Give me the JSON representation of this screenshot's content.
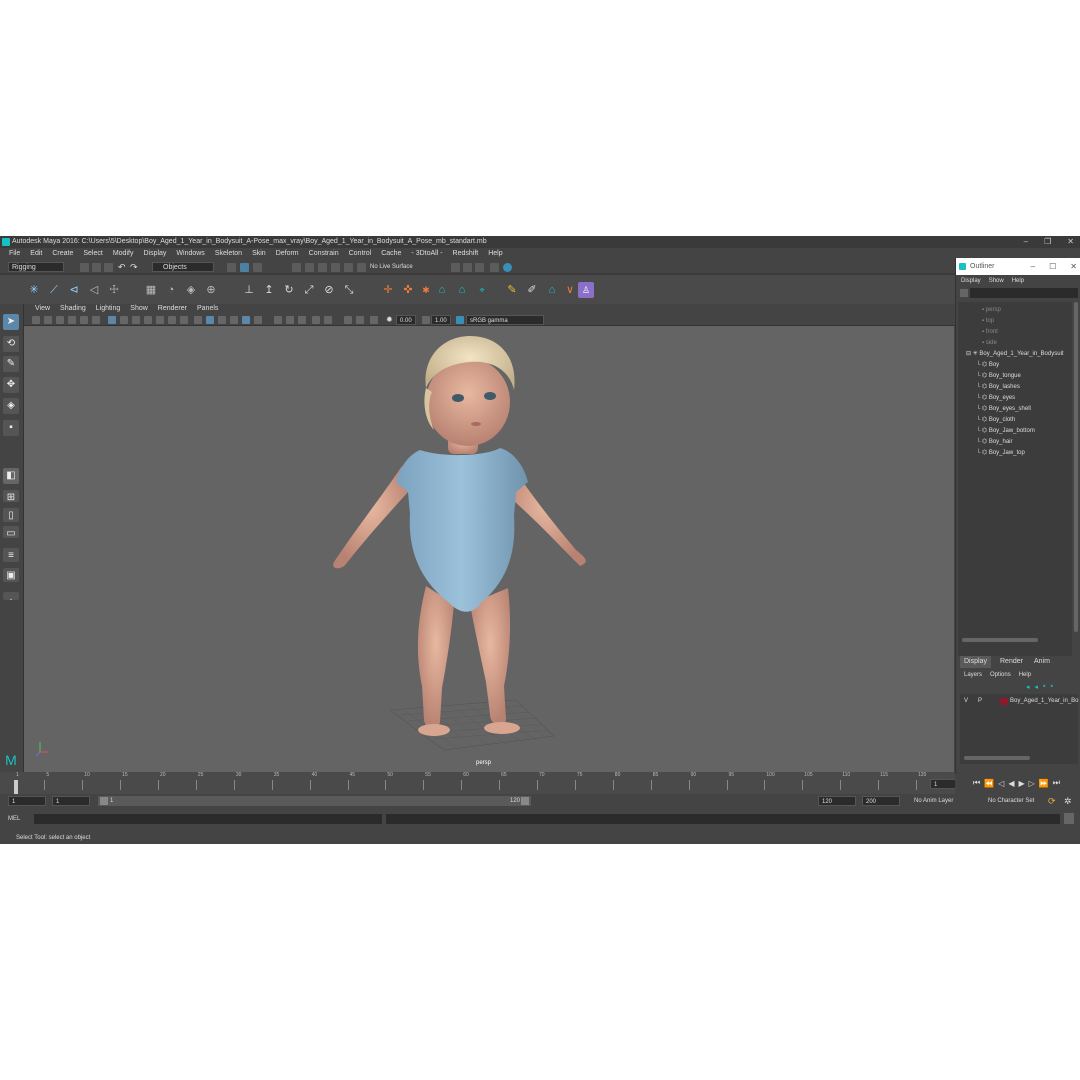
{
  "window": {
    "title": "Autodesk Maya 2016: C:\\Users\\5\\Desktop\\Boy_Aged_1_Year_in_Bodysuit_A-Pose_max_vray\\Boy_Aged_1_Year_in_Bodysuit_A_Pose_mb_standart.mb",
    "minimize": "–",
    "maximize": "❐",
    "close": "✕"
  },
  "menubar": [
    "File",
    "Edit",
    "Create",
    "Select",
    "Modify",
    "Display",
    "Windows",
    "Skeleton",
    "Skin",
    "Deform",
    "Constrain",
    "Control",
    "Cache",
    "- 3DtoAll -",
    "Redshift",
    "Help"
  ],
  "statusline": {
    "menuset": "Rigging",
    "selection_mode": "Objects",
    "live_surface": "No Live Surface"
  },
  "viewport": {
    "menu": [
      "View",
      "Shading",
      "Lighting",
      "Show",
      "Renderer",
      "Panels"
    ],
    "exposure": "0.00",
    "gamma": "1.00",
    "colorspace": "sRGB gamma",
    "camera": "persp"
  },
  "outliner": {
    "title": "Outliner",
    "menu": [
      "Display",
      "Show",
      "Help"
    ],
    "cameras": [
      "persp",
      "top",
      "front",
      "side"
    ],
    "root": "Boy_Aged_1_Year_in_Bodysuit",
    "children": [
      "Boy",
      "Boy_tongue",
      "Boy_lashes",
      "Boy_eyes",
      "Boy_eyes_shell",
      "Boy_cloth",
      "Boy_Jaw_bottom",
      "Boy_hair",
      "Boy_Jaw_top"
    ]
  },
  "layers": {
    "tabs": [
      "Display",
      "Render",
      "Anim"
    ],
    "menu": [
      "Layers",
      "Options",
      "Help"
    ],
    "layer_v": "V",
    "layer_p": "P",
    "layer_name": "Boy_Aged_1_Year_in_Bo",
    "layer_color": "#8b1a2b"
  },
  "timeline": {
    "ticks": [
      "1",
      "5",
      "10",
      "15",
      "20",
      "25",
      "30",
      "35",
      "40",
      "45",
      "50",
      "55",
      "60",
      "65",
      "70",
      "75",
      "80",
      "85",
      "90",
      "95",
      "100",
      "105",
      "110",
      "115",
      "120"
    ],
    "current_frame": "1"
  },
  "range": {
    "start": "1",
    "playback_start": "1",
    "slider_start": "1",
    "slider_end": "120",
    "playback_end": "120",
    "end": "200",
    "anim_layer": "No Anim Layer",
    "char_set": "No Character Set"
  },
  "cmdline": {
    "lang": "MEL"
  },
  "helpline": {
    "text": "Select Tool: select an object"
  },
  "colors": {
    "accent": "#19c2c2",
    "bg": "#444444",
    "viewport": "#646464"
  }
}
